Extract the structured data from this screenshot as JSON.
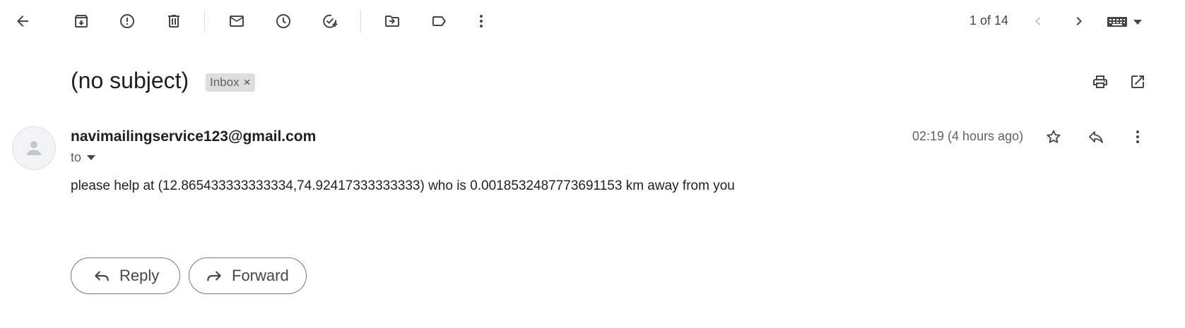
{
  "toolbar": {
    "pager_text": "1 of 14",
    "icons": [
      "back-arrow-icon",
      "archive-icon",
      "report-spam-icon",
      "delete-icon",
      "mark-unread-icon",
      "snooze-icon",
      "add-task-icon",
      "move-to-icon",
      "label-icon",
      "more-vert-icon",
      "chevron-left-icon",
      "chevron-right-icon",
      "keyboard-icon"
    ]
  },
  "message": {
    "subject": "(no subject)",
    "label_chip": "Inbox",
    "chip_close": "×",
    "sender": "navimailingservice123@gmail.com",
    "recipient_label": "to",
    "time": "02:19 (4 hours ago)",
    "body": "please help at (12.865433333333334,74.92417333333333) who is 0.0018532487773691153 km away from you"
  },
  "actions": {
    "reply_label": "Reply",
    "forward_label": "Forward"
  },
  "colors": {
    "icon": "#444746",
    "chip_bg": "#dddddd",
    "text": "#202124"
  }
}
